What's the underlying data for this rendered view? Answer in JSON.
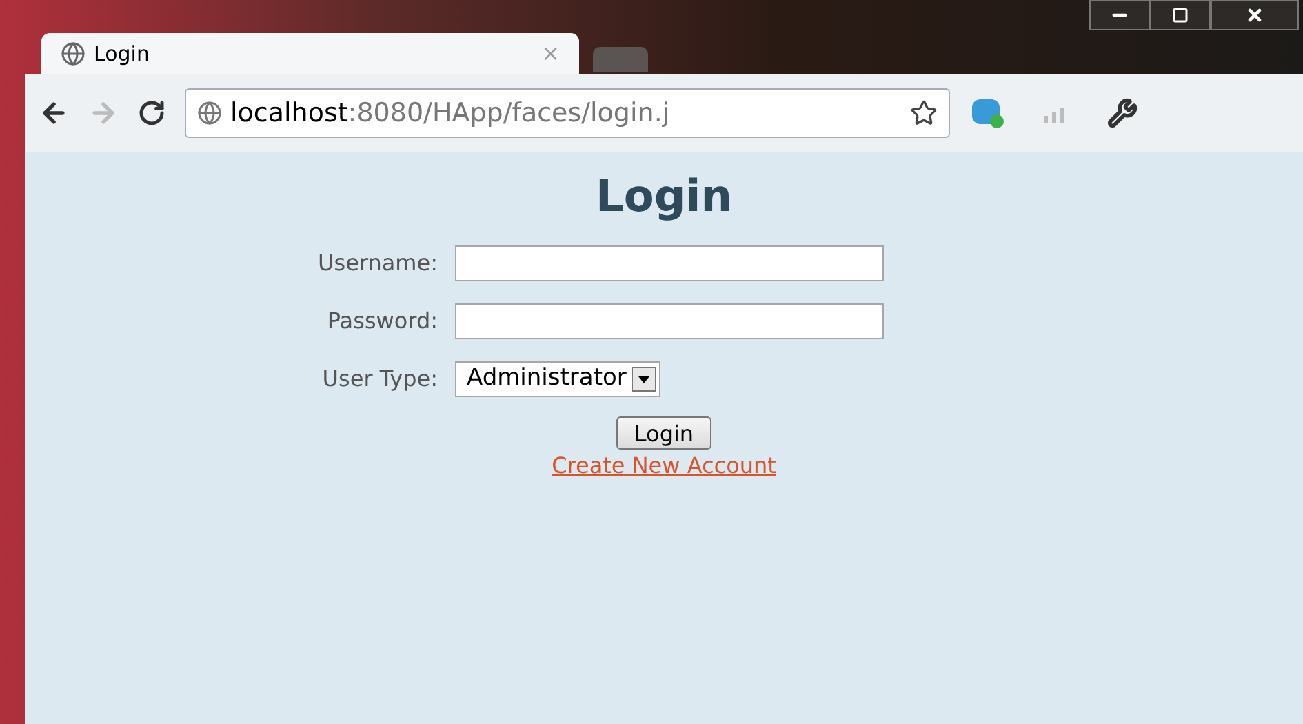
{
  "tab": {
    "title": "Login",
    "close": "×"
  },
  "address": {
    "host": "localhost",
    "path": ":8080/HApp/faces/login.j"
  },
  "page": {
    "heading": "Login",
    "fields": [
      {
        "label": "Username:",
        "kind": "text"
      },
      {
        "label": "Password:",
        "kind": "password"
      },
      {
        "label": "User Type:",
        "kind": "select",
        "value": "Administrator"
      }
    ],
    "button": "Login",
    "link": "Create New Account"
  }
}
